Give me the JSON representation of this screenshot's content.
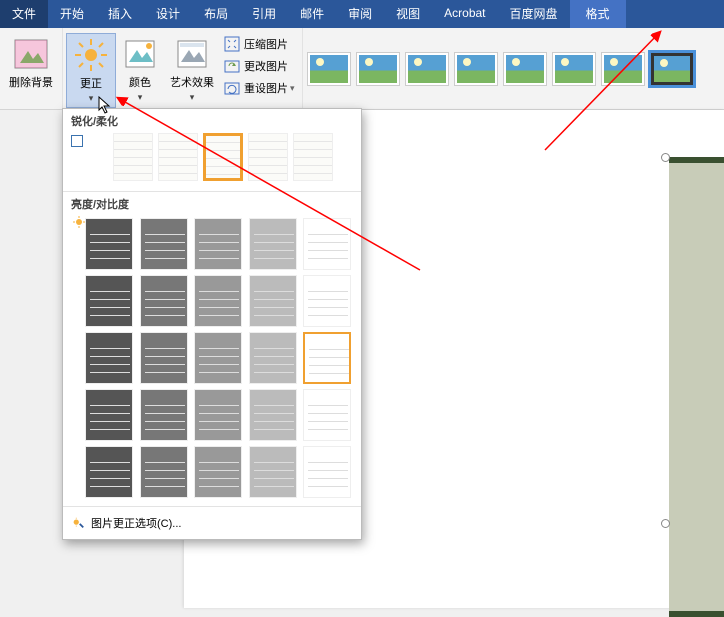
{
  "menu": {
    "file": "文件",
    "items": [
      "开始",
      "插入",
      "设计",
      "布局",
      "引用",
      "邮件",
      "审阅",
      "视图",
      "Acrobat",
      "百度网盘"
    ],
    "format": "格式"
  },
  "ribbon": {
    "remove_bg": "删除背景",
    "corrections": "更正",
    "color": "颜色",
    "artistic": "艺术效果",
    "compress": "压缩图片",
    "change": "更改图片",
    "reset": "重设图片"
  },
  "dropdown": {
    "sharpen_header": "锐化/柔化",
    "brightness_header": "亮度/对比度",
    "options_label": "图片更正选项(C)..."
  }
}
